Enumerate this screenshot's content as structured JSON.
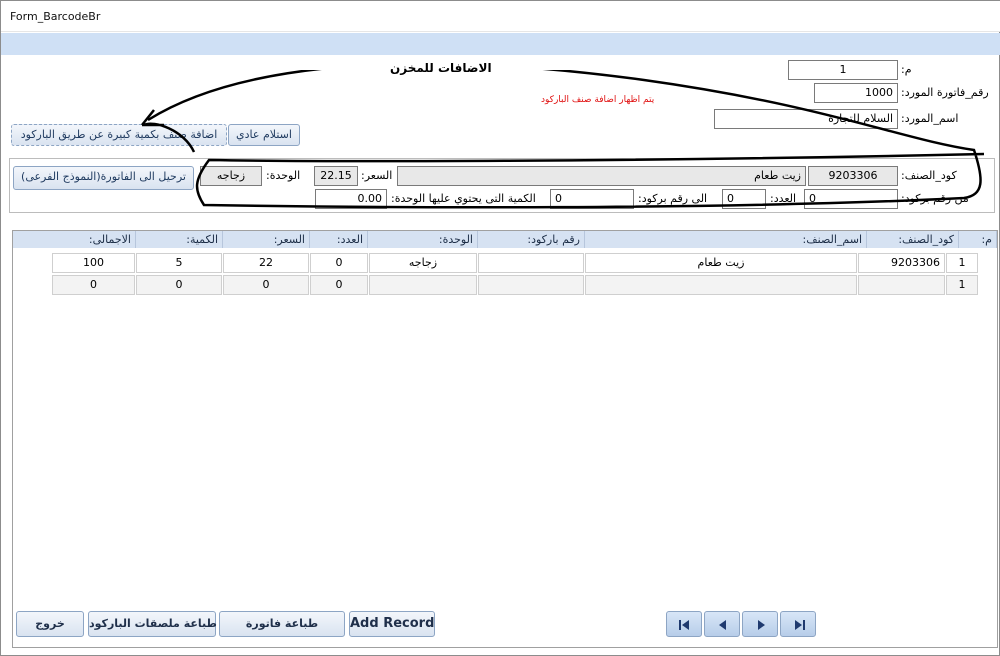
{
  "window": {
    "title": "Form_BarcodeBr"
  },
  "header": {
    "form_title": "الاضافات للمخزن",
    "notice": "يتم اظهار اضافة صنف الباركود",
    "m_label": "م:",
    "m_value": "1",
    "invoice_label": "رقم_فاتورة المورد:",
    "invoice_value": "1000",
    "supplier_label": "اسم_المورد:",
    "supplier_value": "السلام للتجارة"
  },
  "actions": {
    "normal_receive": "استلام عادي",
    "add_large_qty": "اضافة صنف بكمية كبيرة عن طريق الباركود"
  },
  "item_panel": {
    "code_label": "كود_الصنف:",
    "code_value": "9203306",
    "name_value": "زيت طعام",
    "price_label": "السعر:",
    "price_value": "22.15",
    "unit_label": "الوحدة:",
    "unit_value": "زجاجه",
    "from_barcode_label": "من رقم بركود:",
    "from_barcode_value": "0",
    "count_label": "العدد:",
    "count_value": "0",
    "to_barcode_label": "الى رقم بركود:",
    "to_barcode_value": "0",
    "qty_per_unit_label": "الكمية التى يحتوي عليها الوحدة:",
    "qty_per_unit_value": "0.00",
    "post_button": "ترحيل الى الفاتورة(النموذج الفرعى)"
  },
  "grid": {
    "columns": [
      "م:",
      "كود_الصنف:",
      "اسم_الصنف:",
      "رقم باركود:",
      "الوحدة:",
      "العدد:",
      "السعر:",
      "الكمية:",
      "الاجمالى:"
    ],
    "rows": [
      {
        "m": "1",
        "code": "9203306",
        "name": "زيت طعام",
        "barcode": "",
        "unit": "زجاجه",
        "count": "0",
        "price": "22",
        "qty": "5",
        "total": "100"
      },
      {
        "m": "1",
        "code": "",
        "name": "",
        "barcode": "",
        "unit": "",
        "count": "0",
        "price": "0",
        "qty": "0",
        "total": "0"
      }
    ]
  },
  "footer": {
    "exit": "خروج",
    "print_barcode_labels": "طباعة ملصقات الباركود",
    "print_invoice": "طباعة فاتورة",
    "add_record": "Add Record"
  },
  "nav_icons": [
    "first-record-icon",
    "previous-record-icon",
    "next-record-icon",
    "last-record-icon"
  ]
}
